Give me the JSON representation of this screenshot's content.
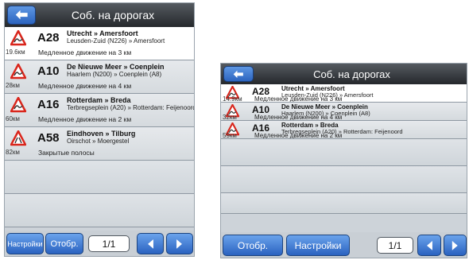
{
  "screens": [
    {
      "title": "Соб. на дорогах",
      "items": [
        {
          "road": "A28",
          "route": "Utrecht » Amersfoort",
          "via": "Leusden-Zuid (N226) » Amersfoort",
          "distance": "19.6км",
          "description": "Медленное движение на 3 км"
        },
        {
          "road": "A10",
          "route": "De Nieuwe Meer » Coenplein",
          "via": "Haarlem (N200) » Coenplein (A8)",
          "distance": "28км",
          "description": "Медленное движение на 4 км"
        },
        {
          "road": "A16",
          "route": "Rotterdam » Breda",
          "via": "Terbregseplein (A20) » Rotterdam: Feijenoord",
          "distance": "60км",
          "description": "Медленное движение на 2 км"
        },
        {
          "road": "A58",
          "route": "Eindhoven » Tilburg",
          "via": "Oirschot » Moergestel",
          "distance": "82км",
          "description": "Закрытые полосы"
        }
      ],
      "buttons": {
        "first": "Настройки",
        "second": "Отобр."
      },
      "page": "1/1"
    },
    {
      "title": "Соб. на дорогах",
      "items": [
        {
          "road": "A28",
          "route": "Utrecht » Amersfoort",
          "via": "Leusden-Zuid (N226) » Amersfoort",
          "distance": "14.9км",
          "description": "Медленное движение на 3 км"
        },
        {
          "road": "A10",
          "route": "De Nieuwe Meer » Coenplein",
          "via": "Haarlem (N200) » Coenplein (A8)",
          "distance": "32км",
          "description": "Медленное движение на 4 км"
        },
        {
          "road": "A16",
          "route": "Rotterdam » Breda",
          "via": "Terbregseplein (A20) » Rotterdam: Feijenoord",
          "distance": "59км",
          "description": "Медленное движение на 2 км"
        }
      ],
      "buttons": {
        "first": "Отобр.",
        "second": "Настройки"
      },
      "page": "1/1"
    }
  ],
  "colors": {
    "accent": "#2c64bf",
    "titlebar": "#25282c",
    "warning": "#d9261c"
  },
  "icons": {
    "back": "arrow-left-icon",
    "warning": "warning-triangle-icon",
    "prev": "chevron-left-icon",
    "next": "chevron-right-icon"
  }
}
